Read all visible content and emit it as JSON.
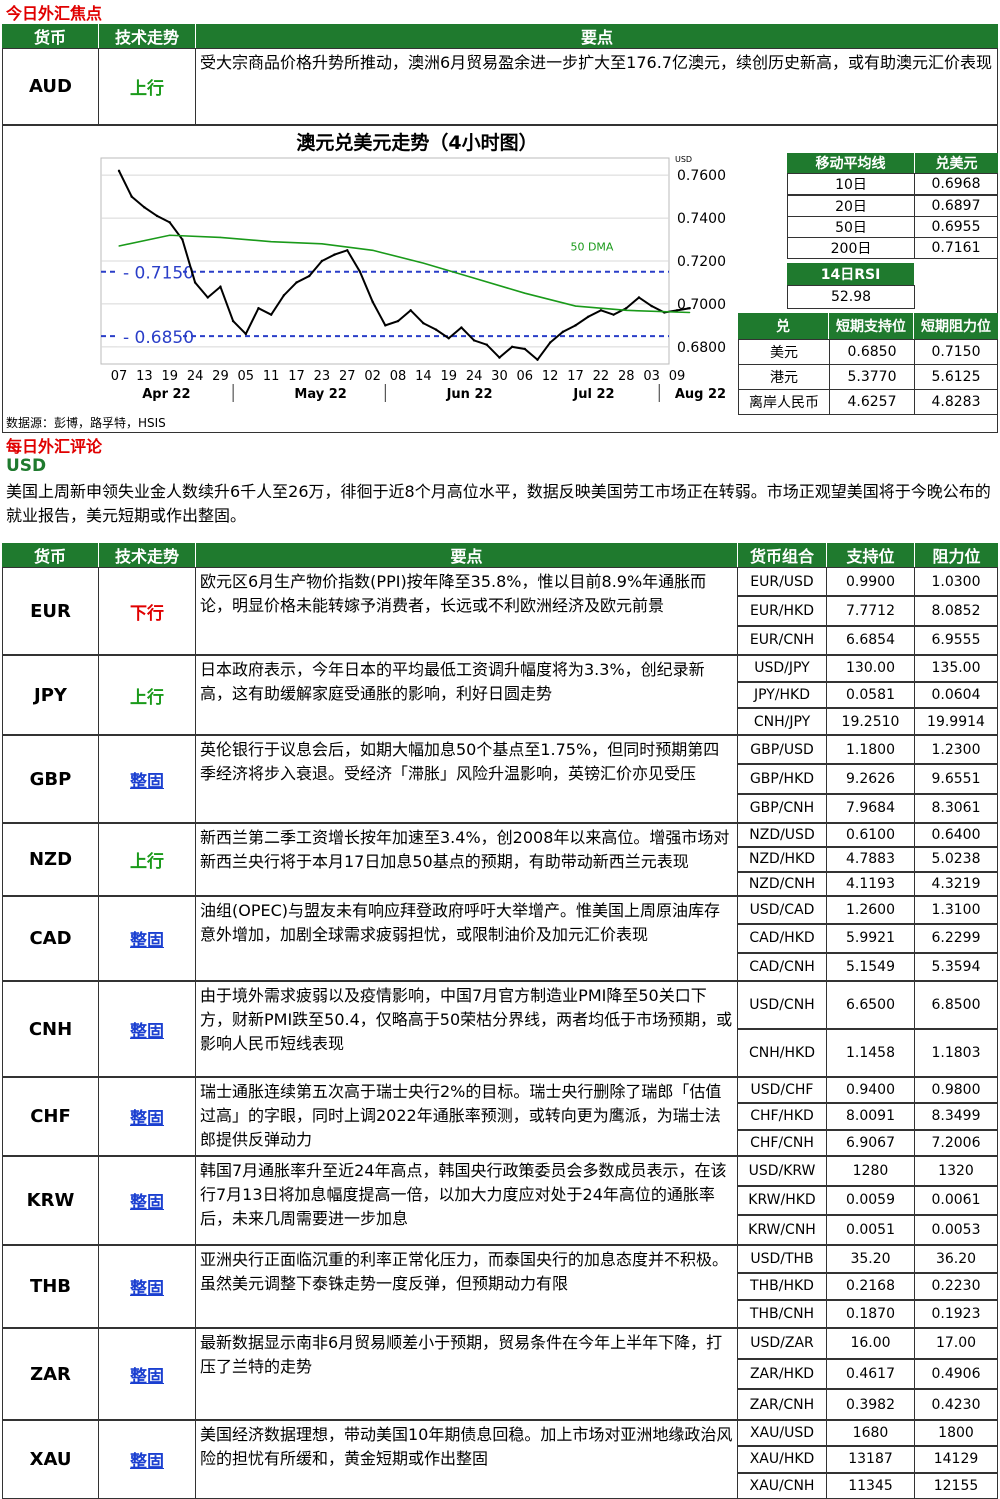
{
  "focus_title": "今日外汇焦点",
  "focus_headers": [
    "货币",
    "技术走势",
    "要点"
  ],
  "focus": {
    "ccy": "AUD",
    "trend": "上行",
    "note": "受大宗商品价格升势所推动，澳洲6月贸易盈余进一步扩大至176.7亿澳元，续创历史新高，或有助澳元汇价表现"
  },
  "chart_data": {
    "type": "line",
    "title": "澳元兑美元走势（4小时图）",
    "unit_label": "USD",
    "y_ticks": [
      "0.7600",
      "0.7400",
      "0.7200",
      "0.7000",
      "0.6800"
    ],
    "ylim": [
      0.672,
      0.768
    ],
    "x_tick_labels": [
      "07",
      "13",
      "19",
      "24",
      "29",
      "05",
      "11",
      "17",
      "23",
      "27",
      "02",
      "08",
      "14",
      "19",
      "24",
      "30",
      "06",
      "12",
      "17",
      "22",
      "28",
      "03",
      "09"
    ],
    "month_labels": [
      "Apr 22",
      "May 22",
      "Jun 22",
      "Jul 22",
      "Aug 22"
    ],
    "series": [
      {
        "name": "AUD/USD",
        "color": "#000000",
        "x": [
          0,
          0.5,
          1,
          1.5,
          2,
          2.5,
          3,
          3.5,
          4,
          4.5,
          5,
          5.5,
          6,
          6.5,
          7,
          7.5,
          8,
          8.5,
          9,
          9.5,
          10,
          10.5,
          11,
          11.5,
          12,
          12.5,
          13,
          13.5,
          14,
          14.5,
          15,
          15.5,
          16,
          16.5,
          17,
          17.5,
          18,
          18.5,
          19,
          19.5,
          20,
          20.5,
          21,
          21.5,
          22,
          22.5
        ],
        "y": [
          0.762,
          0.75,
          0.745,
          0.741,
          0.738,
          0.73,
          0.71,
          0.703,
          0.708,
          0.692,
          0.686,
          0.698,
          0.695,
          0.704,
          0.71,
          0.713,
          0.72,
          0.723,
          0.725,
          0.715,
          0.701,
          0.69,
          0.692,
          0.697,
          0.691,
          0.688,
          0.684,
          0.689,
          0.683,
          0.681,
          0.675,
          0.68,
          0.679,
          0.674,
          0.682,
          0.687,
          0.69,
          0.694,
          0.697,
          0.695,
          0.698,
          0.703,
          0.699,
          0.696,
          0.697,
          0.698
        ]
      },
      {
        "name": "50 DMA",
        "color": "#1a9a1a",
        "x": [
          0,
          2,
          4,
          6,
          8,
          10,
          12,
          14,
          16,
          18,
          20,
          22.5
        ],
        "y": [
          0.727,
          0.732,
          0.731,
          0.729,
          0.728,
          0.725,
          0.719,
          0.712,
          0.705,
          0.699,
          0.697,
          0.696
        ]
      }
    ],
    "ref_lines": [
      {
        "label": "0.7150",
        "value": 0.715
      },
      {
        "label": "0.6850",
        "value": 0.685
      }
    ],
    "annotation": "50 DMA",
    "source": "数据源：彭博，路孚特，HSIS"
  },
  "ma": {
    "headers": [
      "移动平均线",
      "兑美元"
    ],
    "rows": [
      [
        "10日",
        "0.6968"
      ],
      [
        "20日",
        "0.6897"
      ],
      [
        "50日",
        "0.6955"
      ],
      [
        "200日",
        "0.7161"
      ]
    ]
  },
  "rsi": {
    "label": "14日RSI",
    "value": "52.98"
  },
  "levels": {
    "headers": [
      "兑",
      "短期支持位",
      "短期阻力位"
    ],
    "rows": [
      [
        "美元",
        "0.6850",
        "0.7150"
      ],
      [
        "港元",
        "5.3770",
        "5.6125"
      ],
      [
        "离岸人民币",
        "4.6257",
        "4.8283"
      ]
    ]
  },
  "daily_title": "每日外汇评论",
  "usd": {
    "label": "USD",
    "text": "美国上周新申领失业金人数续升6千人至26万，徘徊于近8个月高位水平，数据反映美国劳工市场正在转弱。市场正观望美国将于今晚公布的就业报告，美元短期或作出整固。"
  },
  "main_headers": [
    "货币",
    "技术走势",
    "要点",
    "货币组合",
    "支持位",
    "阻力位"
  ],
  "rows": [
    {
      "ccy": "EUR",
      "trend": "下行",
      "dir": "down",
      "note": "欧元区6月生产物价指数(PPI)按年降至35.8%，惟以目前8.9%年通胀而论，明显价格未能转嫁予消费者，长远或不利欧洲经济及欧元前景",
      "pairs": [
        [
          "EUR/USD",
          "0.9900",
          "1.0300"
        ],
        [
          "EUR/HKD",
          "7.7712",
          "8.0852"
        ],
        [
          "EUR/CNH",
          "6.6854",
          "6.9555"
        ]
      ]
    },
    {
      "ccy": "JPY",
      "trend": "上行",
      "dir": "up",
      "note": "日本政府表示，今年日本的平均最低工资调升幅度将为3.3%，创纪录新高，这有助缓解家庭受通胀的影响，利好日圆走势",
      "pairs": [
        [
          "USD/JPY",
          "130.00",
          "135.00"
        ],
        [
          "JPY/HKD",
          "0.0581",
          "0.0604"
        ],
        [
          "CNH/JPY",
          "19.2510",
          "19.9914"
        ]
      ]
    },
    {
      "ccy": "GBP",
      "trend": "整固",
      "dir": "flat",
      "note": "英伦银行于议息会后，如期大幅加息50个基点至1.75%，但同时预期第四季经济将步入衰退。受经济「滞胀」风险升温影响，英镑汇价亦见受压",
      "pairs": [
        [
          "GBP/USD",
          "1.1800",
          "1.2300"
        ],
        [
          "GBP/HKD",
          "9.2626",
          "9.6551"
        ],
        [
          "GBP/CNH",
          "7.9684",
          "8.3061"
        ]
      ]
    },
    {
      "ccy": "NZD",
      "trend": "上行",
      "dir": "up",
      "note": "新西兰第二季工资增长按年加速至3.4%，创2008年以来高位。增强市场对新西兰央行将于本月17日加息50基点的预期，有助带动新西兰元表现",
      "pairs": [
        [
          "NZD/USD",
          "0.6100",
          "0.6400"
        ],
        [
          "NZD/HKD",
          "4.7883",
          "5.0238"
        ],
        [
          "NZD/CNH",
          "4.1193",
          "4.3219"
        ]
      ]
    },
    {
      "ccy": "CAD",
      "trend": "整固",
      "dir": "flat",
      "note": "油组(OPEC)与盟友未有响应拜登政府呼吁大举增产。惟美国上周原油库存意外增加，加剧全球需求疲弱担忧，或限制油价及加元汇价表现",
      "pairs": [
        [
          "USD/CAD",
          "1.2600",
          "1.3100"
        ],
        [
          "CAD/HKD",
          "5.9921",
          "6.2299"
        ],
        [
          "CAD/CNH",
          "5.1549",
          "5.3594"
        ]
      ]
    },
    {
      "ccy": "CNH",
      "trend": "整固",
      "dir": "flat",
      "note": "由于境外需求疲弱以及疫情影响，中国7月官方制造业PMI降至50关口下方，财新PMI跌至50.4，仅略高于50荣枯分界线，两者均低于市场预期，或影响人民币短线表现",
      "pairs": [
        [
          "USD/CNH",
          "6.6500",
          "6.8500"
        ],
        [
          "CNH/HKD",
          "1.1458",
          "1.1803"
        ]
      ]
    },
    {
      "ccy": "CHF",
      "trend": "整固",
      "dir": "flat",
      "note": "瑞士通胀连续第五次高于瑞士央行2%的目标。瑞士央行删除了瑞郎「估值过高」的字眼，同时上调2022年通胀率预测，或转向更为鹰派，为瑞士法郎提供反弹动力",
      "pairs": [
        [
          "USD/CHF",
          "0.9400",
          "0.9800"
        ],
        [
          "CHF/HKD",
          "8.0091",
          "8.3499"
        ],
        [
          "CHF/CNH",
          "6.9067",
          "7.2006"
        ]
      ]
    },
    {
      "ccy": "KRW",
      "trend": "整固",
      "dir": "flat",
      "note": "韩国7月通胀率升至近24年高点，韩国央行政策委员会多数成员表示，在该行7月13日将加息幅度提高一倍，以加大力度应对处于24年高位的通胀率后，未来几周需要进一步加息",
      "pairs": [
        [
          "USD/KRW",
          "1280",
          "1320"
        ],
        [
          "KRW/HKD",
          "0.0059",
          "0.0061"
        ],
        [
          "KRW/CNH",
          "0.0051",
          "0.0053"
        ]
      ]
    },
    {
      "ccy": "THB",
      "trend": "整固",
      "dir": "flat",
      "note": "亚洲央行正面临沉重的利率正常化压力，而泰国央行的加息态度并不积极。虽然美元调整下泰铢走势一度反弹，但预期动力有限",
      "pairs": [
        [
          "USD/THB",
          "35.20",
          "36.20"
        ],
        [
          "THB/HKD",
          "0.2168",
          "0.2230"
        ],
        [
          "THB/CNH",
          "0.1870",
          "0.1923"
        ]
      ]
    },
    {
      "ccy": "ZAR",
      "trend": "整固",
      "dir": "flat",
      "note": "最新数据显示南非6月贸易顺差小于预期，贸易条件在今年上半年下降，打压了兰特的走势",
      "pairs": [
        [
          "USD/ZAR",
          "16.00",
          "17.00"
        ],
        [
          "ZAR/HKD",
          "0.4617",
          "0.4906"
        ],
        [
          "ZAR/CNH",
          "0.3982",
          "0.4230"
        ]
      ]
    },
    {
      "ccy": "XAU",
      "trend": "整固",
      "dir": "flat",
      "note": "美国经济数据理想，带动美国10年期债息回稳。加上市场对亚洲地缘政治风险的担忧有所缓和，黄金短期或作出整固",
      "pairs": [
        [
          "XAU/USD",
          "1680",
          "1800"
        ],
        [
          "XAU/HKD",
          "13187",
          "14129"
        ],
        [
          "XAU/CNH",
          "11345",
          "12155"
        ]
      ]
    }
  ]
}
